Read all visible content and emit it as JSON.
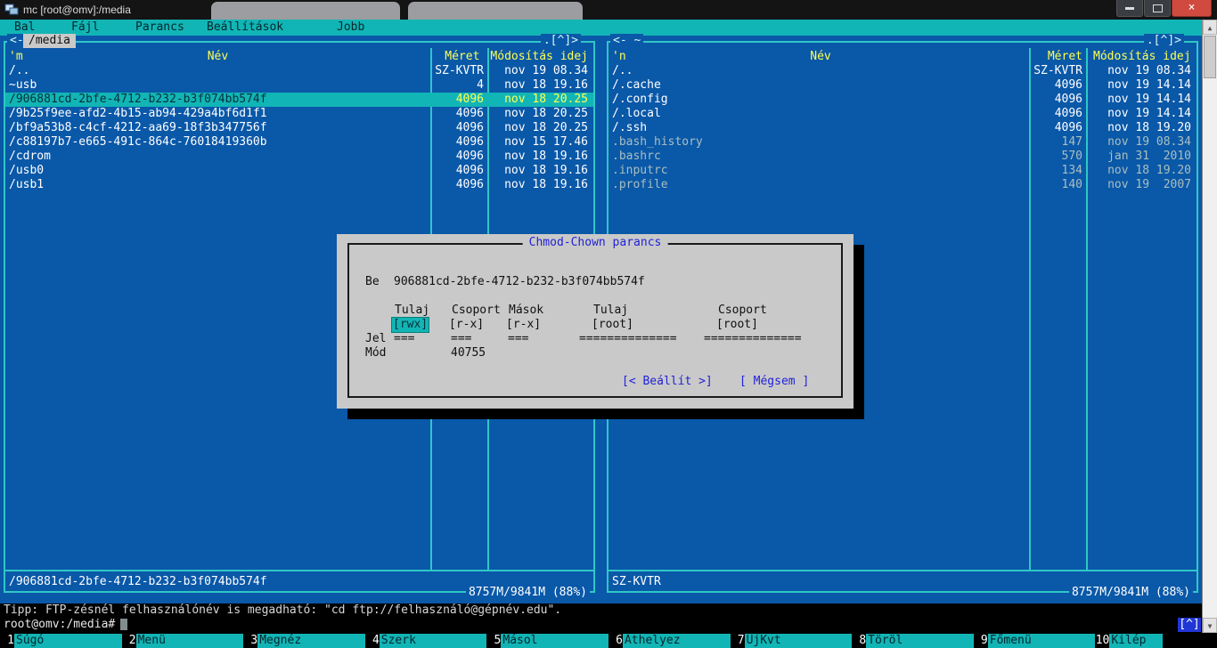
{
  "window": {
    "title": "mc [root@omv]:/media"
  },
  "icons": {
    "close": "×",
    "scroll_up": "▲",
    "scroll_down": "▼"
  },
  "menu": {
    "items": [
      "Bal",
      "Fájl",
      "Parancs",
      "Beállítások",
      "Jobb"
    ]
  },
  "panels": {
    "left": {
      "frame_left": "<-",
      "path": "/media",
      "frame_right": ".[^]>",
      "sort": "'m",
      "col_name": "Név",
      "col_size": "Méret",
      "col_mtime": "Módosítás idej",
      "rows": [
        {
          "name": "/..",
          "size": "SZ-KVTR",
          "mtime": "nov 19 08.34"
        },
        {
          "name": "~usb",
          "size": "4",
          "mtime": "nov 18 19.16"
        },
        {
          "name": "/906881cd-2bfe-4712-b232-b3f074bb574f",
          "size": "4096",
          "mtime": "nov 18 20.25"
        },
        {
          "name": "/9b25f9ee-afd2-4b15-ab94-429a4bf6d1f1",
          "size": "4096",
          "mtime": "nov 18 20.25"
        },
        {
          "name": "/bf9a53b8-c4cf-4212-aa69-18f3b347756f",
          "size": "4096",
          "mtime": "nov 18 20.25"
        },
        {
          "name": "/c88197b7-e665-491c-864c-76018419360b",
          "size": "4096",
          "mtime": "nov 15 17.46"
        },
        {
          "name": "/cdrom",
          "size": "4096",
          "mtime": "nov 18 19.16"
        },
        {
          "name": "/usb0",
          "size": "4096",
          "mtime": "nov 18 19.16"
        },
        {
          "name": "/usb1",
          "size": "4096",
          "mtime": "nov 18 19.16"
        }
      ],
      "mini": "/906881cd-2bfe-4712-b232-b3f074bb574f",
      "usage": "8757M/9841M (88%)"
    },
    "right": {
      "frame_left": "<- ~",
      "frame_right": ".[^]>",
      "sort": "'n",
      "col_name": "Név",
      "col_size": "Méret",
      "col_mtime": "Módosítás idej",
      "rows": [
        {
          "name": "/..",
          "size": "SZ-KVTR",
          "mtime": "nov 19 08.34"
        },
        {
          "name": "/.cache",
          "size": "4096",
          "mtime": "nov 19 14.14"
        },
        {
          "name": "/.config",
          "size": "4096",
          "mtime": "nov 19 14.14"
        },
        {
          "name": "/.local",
          "size": "4096",
          "mtime": "nov 19 14.14"
        },
        {
          "name": "/.ssh",
          "size": "4096",
          "mtime": "nov 18 19.20"
        },
        {
          "name": ".bash_history",
          "size": "147",
          "mtime": "nov 19 08.34"
        },
        {
          "name": ".bashrc",
          "size": "570",
          "mtime": "jan 31  2010"
        },
        {
          "name": ".inputrc",
          "size": "134",
          "mtime": "nov 18 19.20"
        },
        {
          "name": ".profile",
          "size": "140",
          "mtime": "nov 19  2007"
        }
      ],
      "mini": "SZ-KVTR",
      "usage": "8757M/9841M (88%)"
    }
  },
  "dialog": {
    "title": "Chmod-Chown parancs",
    "file_label": "Be",
    "file_name": "906881cd-2bfe-4712-b232-b3f074bb574f",
    "col_owner_perm": "Tulaj",
    "col_group_perm": "Csoport",
    "col_other_perm": "Mások",
    "col_owner": "Tulaj",
    "col_group": "Csoport",
    "owner_perm": "[rwx]",
    "group_perm": "[r-x]",
    "other_perm": "[r-x]",
    "owner": "[root]",
    "group": "[root]",
    "marks_label": "Jel",
    "mark_owner_perm": "===",
    "mark_group_perm": "===",
    "mark_other_perm": "===",
    "mark_owner": "==============",
    "mark_group": "==============",
    "mode_label": "Mód",
    "mode_value": "40755",
    "ok_button": "[< Beállít >]",
    "cancel_button": "[ Mégsem ]"
  },
  "hint": "Tipp: FTP-zésnél felhasználónév is megadható: \"cd ftp://felhasználó@gépnév.edu\".",
  "command": {
    "prompt": "root@omv:/media#",
    "corner": "[^]"
  },
  "fkeys": [
    {
      "num": "1",
      "label": "Súgó"
    },
    {
      "num": "2",
      "label": "Menü"
    },
    {
      "num": "3",
      "label": "Megnéz"
    },
    {
      "num": "4",
      "label": "Szerk"
    },
    {
      "num": "5",
      "label": "Másol"
    },
    {
      "num": "6",
      "label": "Áthelyez"
    },
    {
      "num": "7",
      "label": "ÚjKvt"
    },
    {
      "num": "8",
      "label": "Töröl"
    },
    {
      "num": "9",
      "label": "Főmenü"
    },
    {
      "num": "10",
      "label": "Kilép"
    }
  ],
  "colors": {
    "terminal_blue": "#0a58a8",
    "cyan": "#12b5b5",
    "frame_cyan": "#2fc7c7",
    "header_yellow": "#ffff54",
    "file_gray": "#a9bfbf",
    "dialog_gray": "#c9c9c9",
    "dialog_blue": "#2222d8",
    "close_red": "#d04a3f"
  }
}
